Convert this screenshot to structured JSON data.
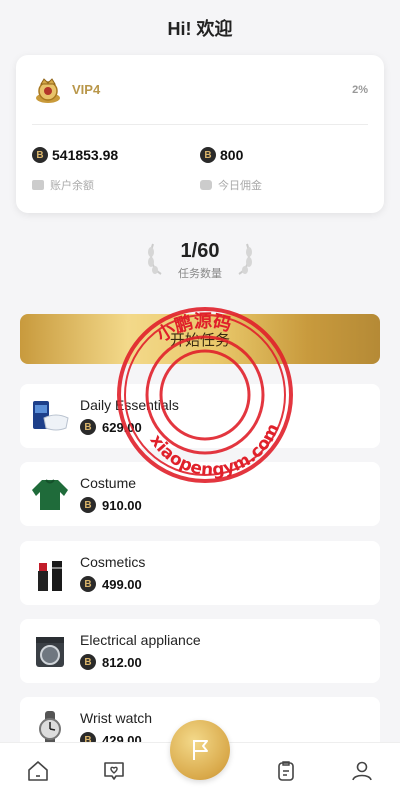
{
  "header": {
    "title": "Hi! 欢迎"
  },
  "account": {
    "vip_label": "VIP4",
    "vip_percent": "2%",
    "balance_value": "541853.98",
    "balance_label": "账户余额",
    "commission_value": "800",
    "commission_label": "今日佣金",
    "coin_glyph": "B"
  },
  "tasks": {
    "count": "1/60",
    "label": "任务数量",
    "start_label": "开始任务"
  },
  "watermark": {
    "top_text": "小鹏源码",
    "bottom_text": "xiaopengym.com"
  },
  "categories": [
    {
      "name": "Daily Essentials",
      "price": "629.00",
      "icon": "boxed-mask-icon"
    },
    {
      "name": "Costume",
      "price": "910.00",
      "icon": "green-sweater-icon"
    },
    {
      "name": "Cosmetics",
      "price": "499.00",
      "icon": "lipstick-icon"
    },
    {
      "name": "Electrical appliance",
      "price": "812.00",
      "icon": "washing-machine-icon"
    },
    {
      "name": "Wrist watch",
      "price": "429.00",
      "icon": "wristwatch-icon"
    }
  ],
  "tabbar": {
    "items": [
      "home-icon",
      "heart-chat-icon",
      "flag-icon",
      "clipboard-icon",
      "user-icon"
    ]
  },
  "colors": {
    "accent_gold": "#c89a3d",
    "vip_gold": "#b9974a",
    "stamp_red": "#e0202a"
  }
}
